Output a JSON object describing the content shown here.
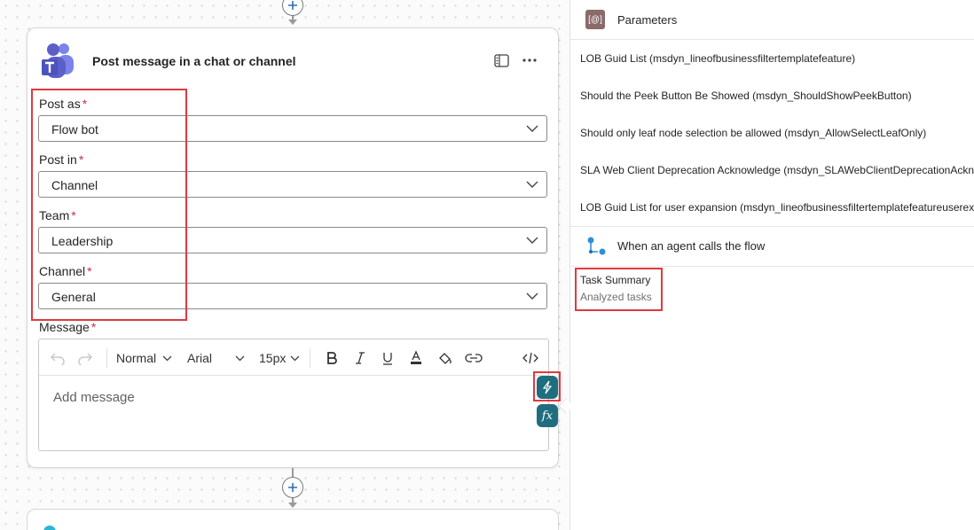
{
  "card": {
    "title": "Post message in a chat or channel",
    "fields": [
      {
        "label": "Post as",
        "required_mark": "*",
        "value": "Flow bot"
      },
      {
        "label": "Post in",
        "required_mark": "*",
        "value": "Channel"
      },
      {
        "label": "Team",
        "required_mark": "*",
        "value": "Leadership"
      },
      {
        "label": "Channel",
        "required_mark": "*",
        "value": "General"
      }
    ],
    "message": {
      "label": "Message",
      "required_mark": "*",
      "placeholder": "Add message",
      "toolbar": {
        "paragraph_style": "Normal",
        "font_family": "Arial",
        "font_size": "15px"
      }
    }
  },
  "panel": {
    "header": "Parameters",
    "parameters": [
      "LOB Guid List (msdyn_lineofbusinessfiltertemplatefeature)",
      "Should the Peek Button Be Showed (msdyn_ShouldShowPeekButton)",
      "Should only leaf node selection be allowed (msdyn_AllowSelectLeafOnly)",
      "SLA Web Client Deprecation Acknowledge (msdyn_SLAWebClientDeprecationAcknowledge)",
      "LOB Guid List for user expansion (msdyn_lineofbusinessfiltertemplatefeatureuserexpansion)"
    ],
    "trigger_section": "When an agent calls the flow",
    "output": {
      "title": "Task Summary",
      "subtitle": "Analyzed tasks"
    }
  },
  "colors": {
    "highlight": "#e0393e",
    "required": "#c4314b",
    "teams_purple": "#5b5fc7",
    "dynamic_button": "#1f6e7f",
    "params_icon": "#8a6a6a"
  },
  "icons": [
    "teams-icon",
    "panel-toggle-icon",
    "more-icon",
    "chevron-down-icon",
    "undo-icon",
    "redo-icon",
    "bold-icon",
    "italic-icon",
    "underline-icon",
    "font-color-icon",
    "highlight-icon",
    "link-icon",
    "code-view-icon",
    "dynamic-content-icon",
    "expression-icon",
    "parameters-icon",
    "agent-flow-icon",
    "add-step-icon"
  ]
}
